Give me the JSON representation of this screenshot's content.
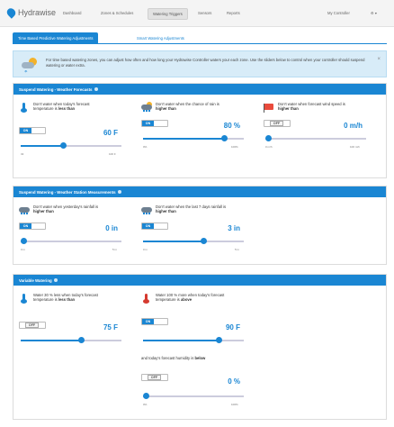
{
  "nav": {
    "logo": "Hydrawise",
    "links": [
      "Dashboard",
      "Zones & Schedules",
      "Watering Triggers",
      "Sensors",
      "Reports"
    ],
    "active_index": 2,
    "controller": "My Controller",
    "settings": "⚙ ▾"
  },
  "tabs": {
    "active": "Time Based Predictive Watering Adjustments",
    "inactive": "Smart Watering Adjustments"
  },
  "info": {
    "text": "For time based watering zones, you can adjust how often and how long your Hydrawise Controller waters your each zone. Use the sliders below to control when your controller should suspend watering or water extra.",
    "close": "×"
  },
  "forecast": {
    "title": "Suspend Watering - Weather Forecasts",
    "cards": [
      {
        "desc_pre": "Don't water when today's forecast temperature is ",
        "desc_bold": "less than",
        "toggle": "ON",
        "toggle_on": true,
        "value": "60 F",
        "min": "32",
        "max": "100 F",
        "level": 0.42
      },
      {
        "desc_pre": "Don't water when the chance of rain is ",
        "desc_bold": "higher than",
        "toggle": "ON",
        "toggle_on": true,
        "value": "80 %",
        "min": "0%",
        "max": "100%",
        "level": 0.8
      },
      {
        "desc_pre": "Don't water when forecast wind speed is ",
        "desc_bold": "higher than",
        "toggle": "OFF",
        "toggle_on": false,
        "value": "0 m/h",
        "min": "0 m/h",
        "max": "100 m/h",
        "level": 0.0
      }
    ]
  },
  "station": {
    "title": "Suspend Watering - Weather Station Measurements",
    "cards": [
      {
        "desc_pre": "Don't water when yesterday's rainfall is ",
        "desc_bold": "higher than",
        "toggle": "ON",
        "toggle_on": true,
        "value": "0 in",
        "min": "0 in",
        "max": "5 in",
        "level": 0.0
      },
      {
        "desc_pre": "Don't water when the last 7 days rainfall is ",
        "desc_bold": "higher than",
        "toggle": "ON",
        "toggle_on": true,
        "value": "3 in",
        "min": "0 in",
        "max": "5 in",
        "level": 0.6
      }
    ]
  },
  "variable": {
    "title": "Variable Watering",
    "cards": [
      {
        "desc_pre": "Water 30 % less when today's forecast temperature is ",
        "desc_bold": "less than",
        "toggle": "OFF",
        "toggle_on": false,
        "value": "75 F",
        "level": 0.6
      },
      {
        "desc_pre": "Water 100 % more when today's forecast temperature is ",
        "desc_bold": "above",
        "toggle": "ON",
        "toggle_on": true,
        "value": "90 F",
        "level": 0.75
      }
    ],
    "humidity": {
      "desc_pre": "and today's forecast humidity is ",
      "desc_bold": "below",
      "toggle": "OFF",
      "toggle_on": false,
      "value": "0 %",
      "min": "0%",
      "max": "100%",
      "level": 0.0
    }
  },
  "colors": {
    "accent": "#1a86d3",
    "info_bg": "#d8ecf8",
    "alert_red": "#d53a2f",
    "sun": "#f3b22b"
  }
}
